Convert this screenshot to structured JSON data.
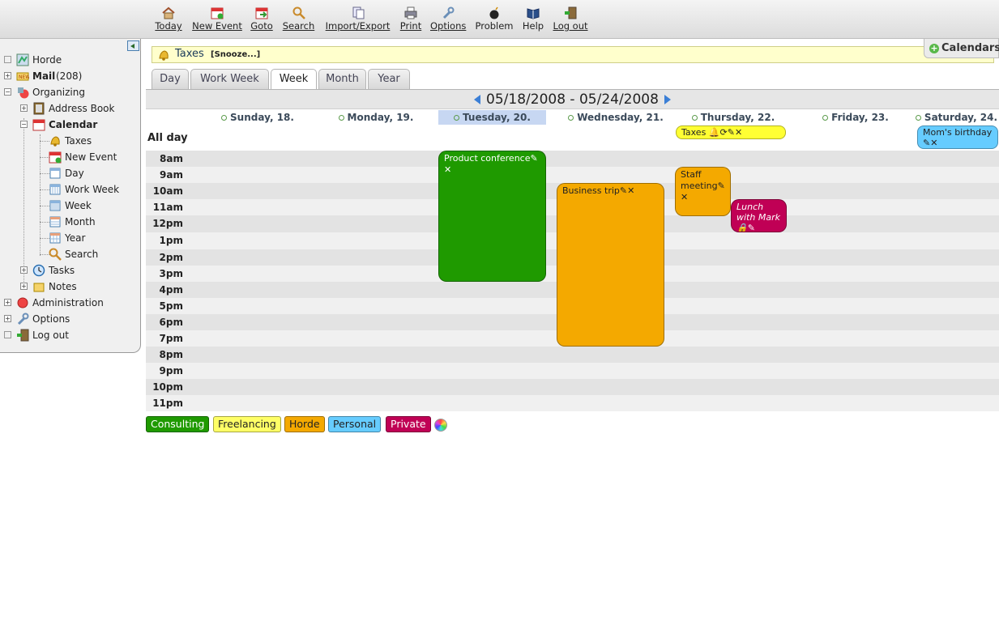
{
  "toolbar": {
    "items": [
      {
        "label": "Today",
        "icon": "home-icon"
      },
      {
        "label": "New Event",
        "icon": "new-event-icon"
      },
      {
        "label": "Goto",
        "icon": "goto-icon"
      },
      {
        "label": "Search",
        "icon": "search-icon"
      },
      {
        "label": "Import/Export",
        "icon": "import-export-icon"
      },
      {
        "label": "Print",
        "icon": "print-icon"
      },
      {
        "label": "Options",
        "icon": "wrench-icon"
      },
      {
        "label": "Problem",
        "icon": "bomb-icon"
      },
      {
        "label": "Help",
        "icon": "book-icon"
      },
      {
        "label": "Log out",
        "icon": "logout-icon"
      }
    ]
  },
  "sidebar": {
    "horde": "Horde",
    "mail": "Mail",
    "mail_count": "(208)",
    "organizing": "Organizing",
    "address_book": "Address Book",
    "calendar": "Calendar",
    "cal_items": [
      "Taxes",
      "New Event",
      "Day",
      "Work Week",
      "Week",
      "Month",
      "Year",
      "Search"
    ],
    "tasks": "Tasks",
    "notes": "Notes",
    "administration": "Administration",
    "options": "Options",
    "logout": "Log out"
  },
  "alarm": {
    "title": "Taxes",
    "snooze": "[Snooze...]"
  },
  "calendars_toggle": "Calendars",
  "tabs": [
    "Day",
    "Work Week",
    "Week",
    "Month",
    "Year"
  ],
  "active_tab": "Week",
  "date_range": "05/18/2008 - 05/24/2008",
  "days": [
    "Sunday, 18.",
    "Monday, 19.",
    "Tuesday, 20.",
    "Wednesday, 21.",
    "Thursday, 22.",
    "Friday, 23.",
    "Saturday, 24."
  ],
  "today": "Tuesday, 20.",
  "all_day_label": "All day",
  "hours": [
    "8am",
    "9am",
    "10am",
    "11am",
    "12pm",
    "1pm",
    "2pm",
    "3pm",
    "4pm",
    "5pm",
    "6pm",
    "7pm",
    "8pm",
    "9pm",
    "10pm",
    "11pm"
  ],
  "events": {
    "taxes": {
      "title": "Taxes",
      "icons": "🔔⟳✎✕"
    },
    "moms_birthday": {
      "title": "Mom's birthday",
      "icons": "✎✕"
    },
    "product_conference": {
      "title": "Product conference",
      "icons": "✎",
      "x": "✕"
    },
    "business_trip": {
      "title": "Business trip",
      "icons": "✎✕"
    },
    "staff_meeting": {
      "title": "Staff meeting",
      "icons": "✎",
      "x": "✕"
    },
    "lunch_with_mark": {
      "title": "Lunch with Mark",
      "icons": "🔒✎",
      "x": "✕"
    }
  },
  "legend": [
    {
      "label": "Consulting",
      "color": "#1f9a00"
    },
    {
      "label": "Freelancing",
      "color": "#ffff66"
    },
    {
      "label": "Horde",
      "color": "#f4a900"
    },
    {
      "label": "Personal",
      "color": "#66ccff"
    },
    {
      "label": "Private",
      "color": "#c00055"
    }
  ]
}
